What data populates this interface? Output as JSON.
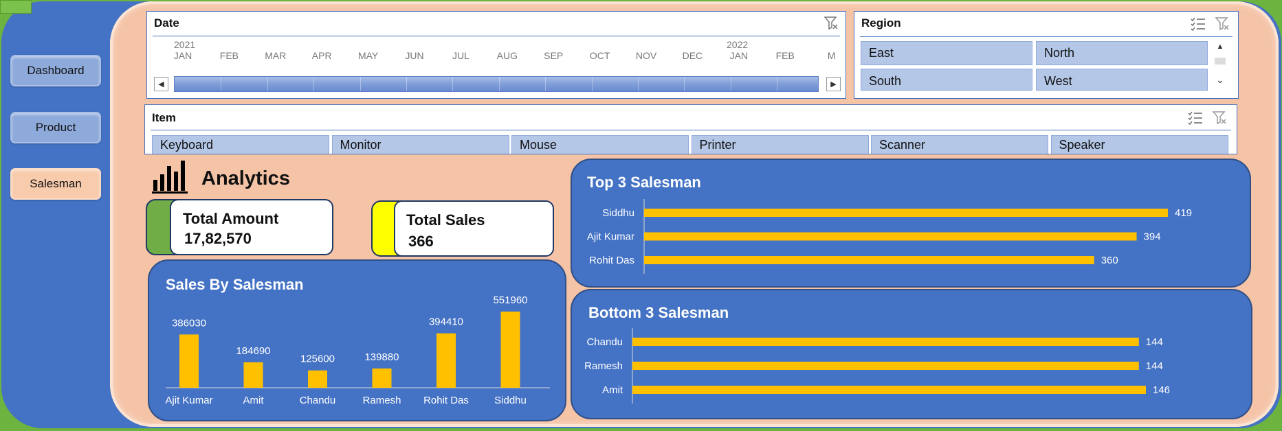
{
  "nav": {
    "items": [
      {
        "label": "Dashboard",
        "active": false
      },
      {
        "label": "Product",
        "active": false
      },
      {
        "label": "Salesman",
        "active": true
      }
    ]
  },
  "date_slicer": {
    "title": "Date",
    "years": [
      "2021",
      "2022"
    ],
    "months": [
      "JAN",
      "FEB",
      "MAR",
      "APR",
      "MAY",
      "JUN",
      "JUL",
      "AUG",
      "SEP",
      "OCT",
      "NOV",
      "DEC",
      "JAN",
      "FEB",
      "M"
    ],
    "clear_icon": "filter-clear-icon"
  },
  "region_slicer": {
    "title": "Region",
    "items": [
      "East",
      "North",
      "South",
      "West"
    ],
    "multiselect_icon": "multi-select-icon",
    "clear_icon": "filter-clear-icon"
  },
  "item_slicer": {
    "title": "Item",
    "items": [
      "Keyboard",
      "Monitor",
      "Mouse",
      "Printer",
      "Scanner",
      "Speaker"
    ],
    "multiselect_icon": "multi-select-icon",
    "clear_icon": "filter-clear-icon"
  },
  "analytics": {
    "title": "Analytics",
    "icon": "bar-chart-icon"
  },
  "kpis": {
    "total_amount_label": "Total Amount",
    "total_amount_value": "17,82,570",
    "total_sales_label": "Total Sales",
    "total_sales_value": "366"
  },
  "colors": {
    "card_blue": "#4472c4",
    "bar_gold": "#ffc000",
    "panel_peach": "#f5c3a6",
    "kpi_green": "#70ad47",
    "kpi_yellow": "#ffff00"
  },
  "chart_data": [
    {
      "type": "bar",
      "title": "Sales By Salesman",
      "categories": [
        "Ajit Kumar",
        "Amit",
        "Chandu",
        "Ramesh",
        "Rohit Das",
        "Siddhu"
      ],
      "values": [
        386030,
        184690,
        125600,
        139880,
        394410,
        551960
      ]
    },
    {
      "type": "bar",
      "orientation": "horizontal",
      "title": "Top 3 Salesman",
      "categories": [
        "Siddhu",
        "Ajit Kumar",
        "Rohit Das"
      ],
      "values": [
        419,
        394,
        360
      ]
    },
    {
      "type": "bar",
      "orientation": "horizontal",
      "title": "Bottom 3 Salesman",
      "categories": [
        "Chandu",
        "Ramesh",
        "Amit"
      ],
      "values": [
        144,
        144,
        146
      ]
    }
  ]
}
